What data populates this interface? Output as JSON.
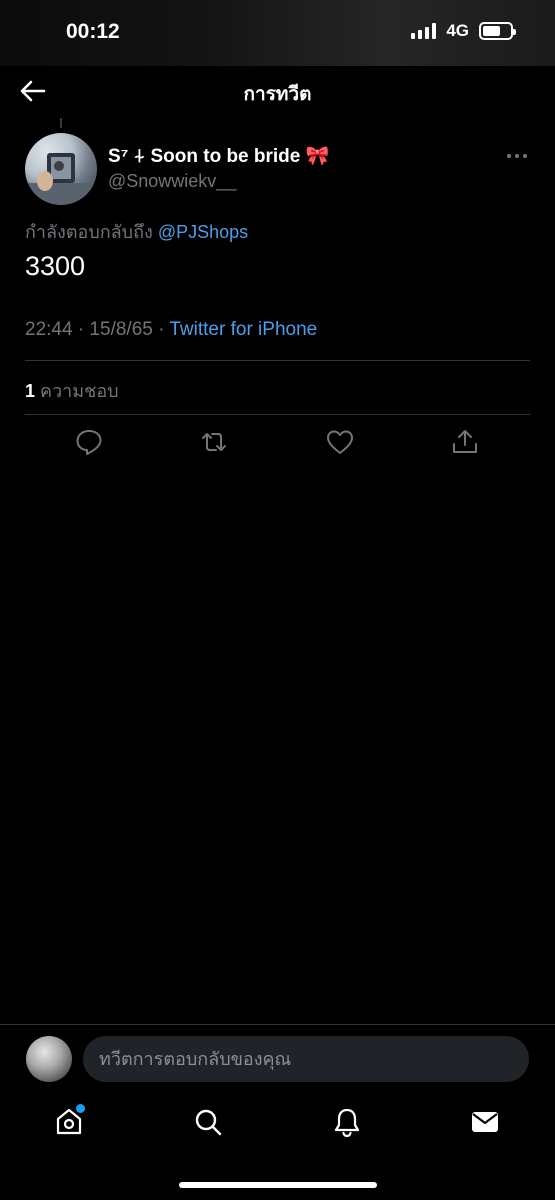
{
  "status_bar": {
    "time": "00:12",
    "network": "4G",
    "battery_level": 0.65
  },
  "header": {
    "title": "การทวีต",
    "back_icon": "back-arrow-icon"
  },
  "tweet": {
    "display_name": "S⁷ ⍭ Soon to be bride 🎀",
    "username": "@Snowwiekv__",
    "reply_prefix": "กำลังตอบกลับถึง",
    "reply_mention": "@PJShops",
    "text": "3300",
    "timestamp": "22:44 · 15/8/65 ·",
    "source": "Twitter for iPhone",
    "like_count": "1",
    "like_label": "ความชอบ"
  },
  "actions": [
    "reply-icon",
    "retweet-icon",
    "like-icon",
    "share-icon"
  ],
  "composer": {
    "placeholder": "ทวีตการตอบกลับของคุณ"
  },
  "tabs": [
    "home-icon",
    "search-icon",
    "notifications-icon",
    "messages-icon"
  ],
  "colors": {
    "accent": "#1d9bf0",
    "link": "#4a9eea",
    "secondary_text": "#71767b",
    "background": "#000000"
  }
}
